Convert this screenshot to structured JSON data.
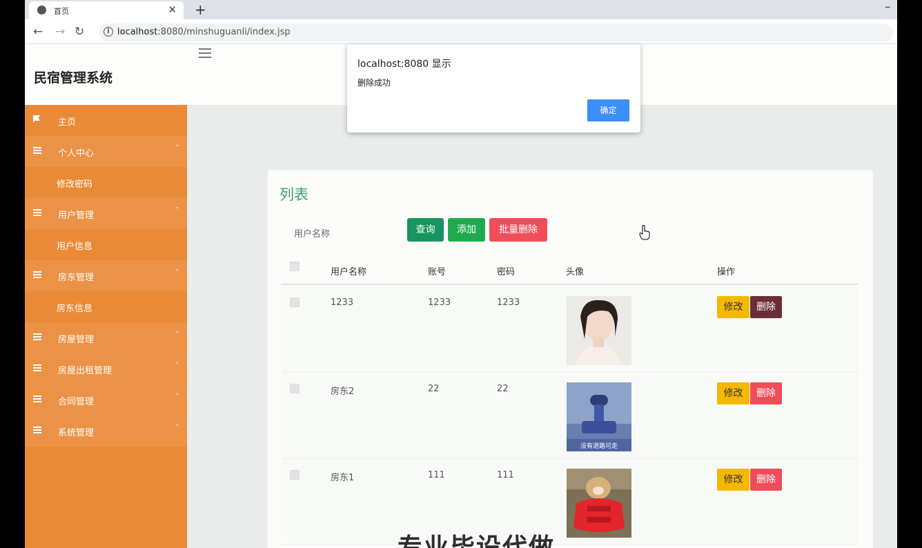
{
  "browser": {
    "tab_title": "首页",
    "tab_close": "✕",
    "new_tab": "+",
    "minimize": "–",
    "back": "←",
    "forward": "→",
    "reload": "↻",
    "info_glyph": "i",
    "url_host": "localhost",
    "url_rest": ":8080/minshuguanli/index.jsp"
  },
  "header": {
    "brand": "民宿管理系统"
  },
  "sidebar": {
    "items": [
      {
        "label": "主页",
        "kind": "home",
        "icon": "flag-icon"
      },
      {
        "label": "个人中心",
        "kind": "parent",
        "icon": "grid-icon",
        "arrow": "˄"
      },
      {
        "label": "修改密码",
        "kind": "child"
      },
      {
        "label": "用户管理",
        "kind": "parent",
        "icon": "grid-icon",
        "arrow": "˄"
      },
      {
        "label": "用户信息",
        "kind": "child"
      },
      {
        "label": "房东管理",
        "kind": "parent",
        "icon": "grid-icon",
        "arrow": "˄"
      },
      {
        "label": "房东信息",
        "kind": "child"
      },
      {
        "label": "房屋管理",
        "kind": "parent",
        "icon": "grid-icon",
        "arrow": "˅"
      },
      {
        "label": "房屋出租管理",
        "kind": "parent",
        "icon": "grid-icon",
        "arrow": "˅"
      },
      {
        "label": "合同管理",
        "kind": "parent",
        "icon": "grid-icon",
        "arrow": "˅"
      },
      {
        "label": "系统管理",
        "kind": "parent",
        "icon": "grid-icon",
        "arrow": "˅"
      }
    ]
  },
  "card": {
    "title": "列表",
    "search_placeholder": "用户名称",
    "query_button": "查询",
    "add_button": "添加",
    "batch_delete_button": "批量删除",
    "colors": {
      "query": "#17955e",
      "add": "#21a94f",
      "batch_delete": "#ef4d5a"
    }
  },
  "table": {
    "headers": [
      "用户名称",
      "账号",
      "密码",
      "头像",
      "操作"
    ],
    "rows": [
      {
        "name": "1233",
        "account": "1233",
        "password": "1233",
        "avatar": "portrait",
        "edit": "修改",
        "delete": "删除"
      },
      {
        "name": "房东2",
        "account": "22",
        "password": "22",
        "avatar": "figure",
        "avatar_caption": "没有退路可走",
        "edit": "修改",
        "delete": "删除"
      },
      {
        "name": "房东1",
        "account": "111",
        "password": "111",
        "avatar": "dog",
        "edit": "修改",
        "delete": "删除"
      }
    ]
  },
  "dialog": {
    "title": "localhost:8080 显示",
    "message": "删除成功",
    "ok": "确定"
  },
  "watermark": "专业毕设代做"
}
